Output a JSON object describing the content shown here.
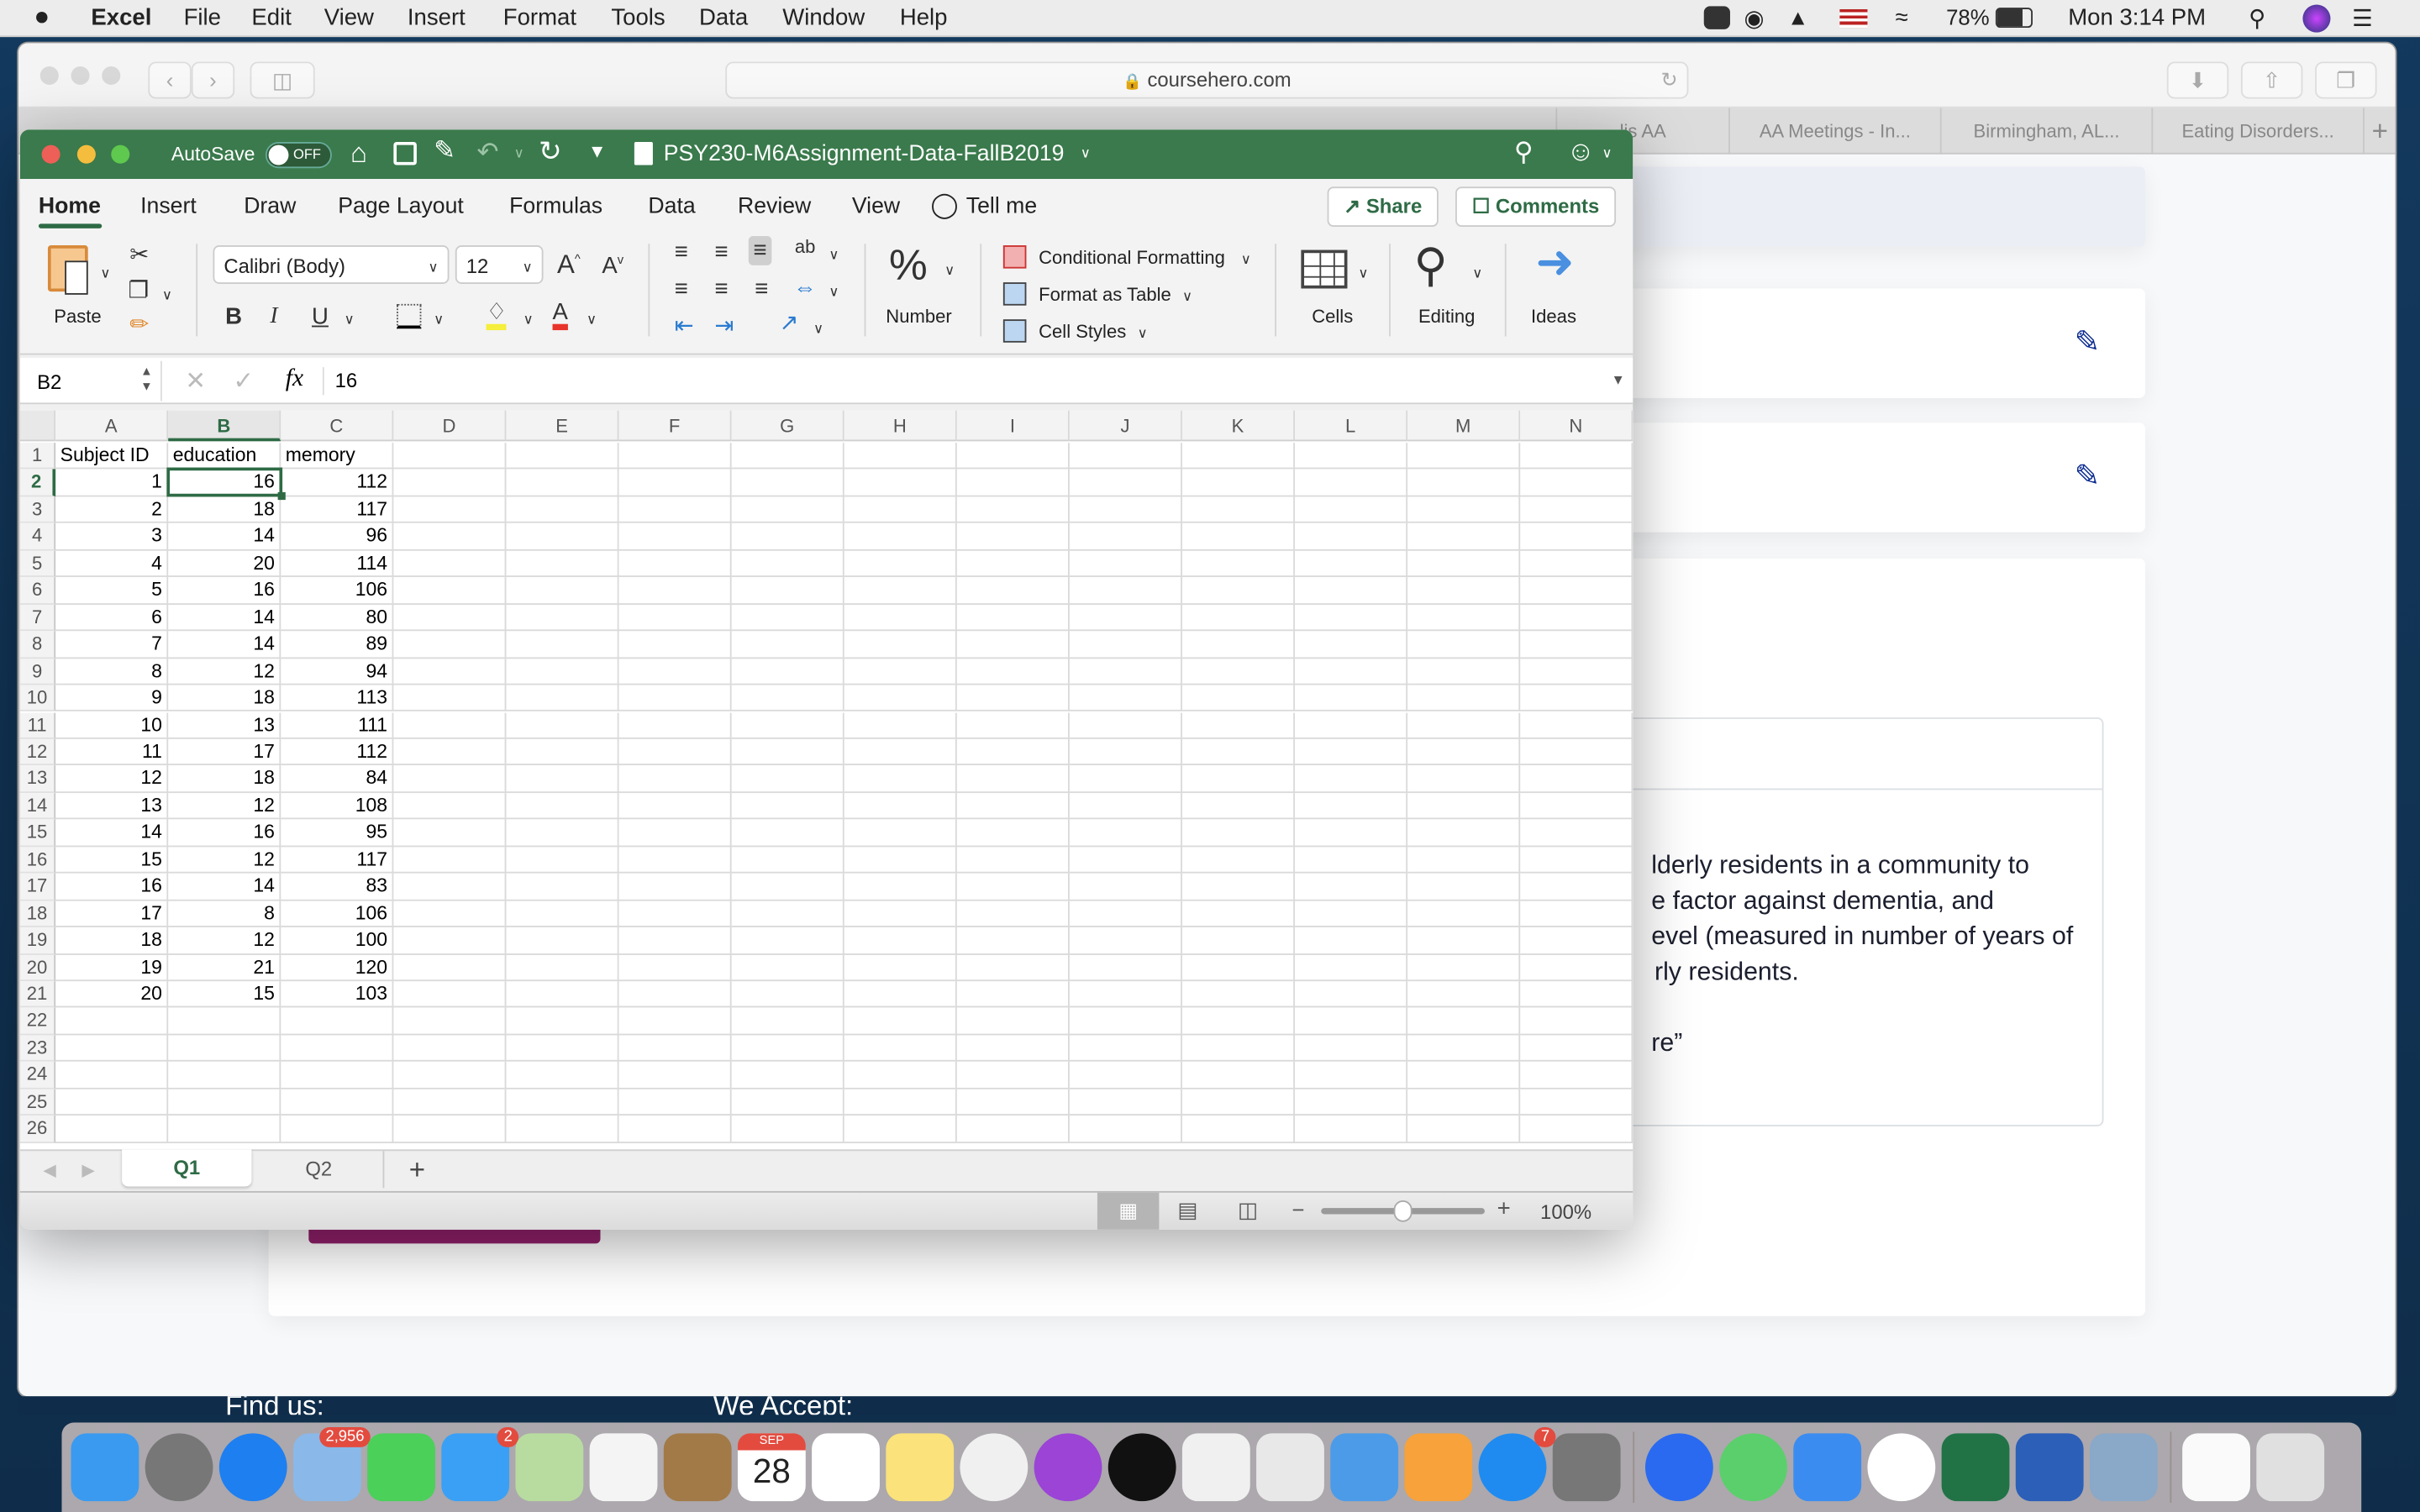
{
  "menubar": {
    "app": "Excel",
    "items": [
      "File",
      "Edit",
      "View",
      "Insert",
      "Format",
      "Tools",
      "Data",
      "Window",
      "Help"
    ],
    "battery": "78%",
    "clock": "Mon 3:14 PM"
  },
  "safari": {
    "url": "coursehero.com",
    "tabs": [
      "lis AA",
      "AA Meetings - In...",
      "Birmingham, AL...",
      "Eating Disorders..."
    ],
    "content_lines": [
      "lderly residents in a community to",
      "e factor against dementia, and",
      "evel (measured in number of years of",
      "rly residents.",
      "re”"
    ],
    "footer": {
      "find_us": "Find us:",
      "we_accept": "We Accept:"
    }
  },
  "excel": {
    "autosave_label": "AutoSave",
    "autosave_state": "OFF",
    "title": "PSY230-M6Assignment-Data-FallB2019",
    "tabs": [
      "Home",
      "Insert",
      "Draw",
      "Page Layout",
      "Formulas",
      "Data",
      "Review",
      "View",
      "Tell me"
    ],
    "active_tab": "Home",
    "share": "Share",
    "comments": "Comments",
    "ribbon": {
      "paste": "Paste",
      "font": "Calibri (Body)",
      "size": "12",
      "bold": "B",
      "italic": "I",
      "underline": "U",
      "number": "Number",
      "conditional_formatting": "Conditional Formatting",
      "format_as_table": "Format as Table",
      "cell_styles": "Cell Styles",
      "cells": "Cells",
      "editing": "Editing",
      "ideas": "Ideas"
    },
    "name_box": "B2",
    "formula_value": "16",
    "fx": "fx",
    "columns": [
      "A",
      "B",
      "C",
      "D",
      "E",
      "F",
      "G",
      "H",
      "I",
      "J",
      "K",
      "L",
      "M",
      "N"
    ],
    "selected_cell": "B2",
    "rows": [
      [
        "Subject ID",
        "education",
        "memory"
      ],
      [
        "1",
        "16",
        "112"
      ],
      [
        "2",
        "18",
        "117"
      ],
      [
        "3",
        "14",
        "96"
      ],
      [
        "4",
        "20",
        "114"
      ],
      [
        "5",
        "16",
        "106"
      ],
      [
        "6",
        "14",
        "80"
      ],
      [
        "7",
        "14",
        "89"
      ],
      [
        "8",
        "12",
        "94"
      ],
      [
        "9",
        "18",
        "113"
      ],
      [
        "10",
        "13",
        "111"
      ],
      [
        "11",
        "17",
        "112"
      ],
      [
        "12",
        "18",
        "84"
      ],
      [
        "13",
        "12",
        "108"
      ],
      [
        "14",
        "16",
        "95"
      ],
      [
        "15",
        "12",
        "117"
      ],
      [
        "16",
        "14",
        "83"
      ],
      [
        "17",
        "8",
        "106"
      ],
      [
        "18",
        "12",
        "100"
      ],
      [
        "19",
        "21",
        "120"
      ],
      [
        "20",
        "15",
        "103"
      ]
    ],
    "row_count": 26,
    "sheets": [
      "Q1",
      "Q2"
    ],
    "active_sheet": "Q1",
    "add_sheet": "+",
    "zoom": "100%",
    "zoom_percent": 100,
    "colors": {
      "titlebar": "#3a7a4c",
      "accent": "#217346"
    }
  },
  "dock": {
    "badges": {
      "mail": "2,956",
      "messages": "2",
      "app_store": "7"
    },
    "calendar": {
      "month": "SEP",
      "day": "28"
    }
  }
}
